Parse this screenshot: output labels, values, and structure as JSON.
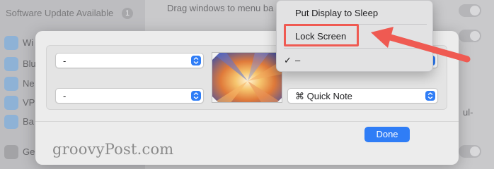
{
  "background": {
    "software_update_label": "Software Update Available",
    "software_update_badge": "1",
    "row_1_text": "Drag windows to menu ba",
    "sidebar_items": [
      "Wi",
      "Blu",
      "Ne",
      "VP",
      "Ba",
      "Ge"
    ],
    "suffix_1": "ul-"
  },
  "hot_corners": {
    "top_left": "-",
    "bottom_left": "-",
    "bottom_right": "⌘ Quick Note"
  },
  "menu": {
    "items": [
      "Put Display to Sleep",
      "Lock Screen",
      "–"
    ],
    "checked_label": "✓"
  },
  "dialog": {
    "done_label": "Done"
  },
  "watermark": "groovyPost.com",
  "colors": {
    "accent": "#2f7df6",
    "annotation": "#ef5a52"
  }
}
